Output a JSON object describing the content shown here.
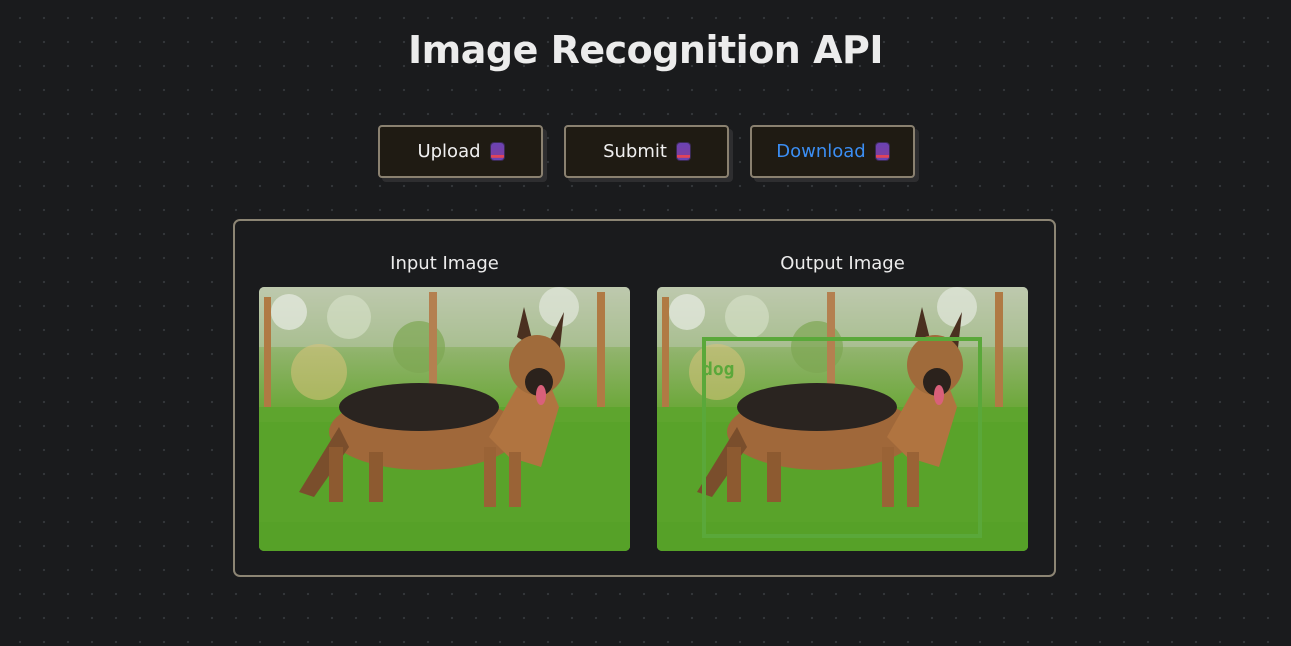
{
  "page": {
    "title": "Image Recognition API"
  },
  "toolbar": {
    "buttons": [
      {
        "label": "Upload",
        "icon": "book-icon"
      },
      {
        "label": "Submit",
        "icon": "book-icon"
      },
      {
        "label": "Download",
        "icon": "book-icon",
        "color": "#3b8ef3"
      }
    ]
  },
  "panel": {
    "input": {
      "label": "Input Image"
    },
    "output": {
      "label": "Output Image",
      "detection_label": "dog",
      "detection_color": "#5aa83a"
    }
  }
}
